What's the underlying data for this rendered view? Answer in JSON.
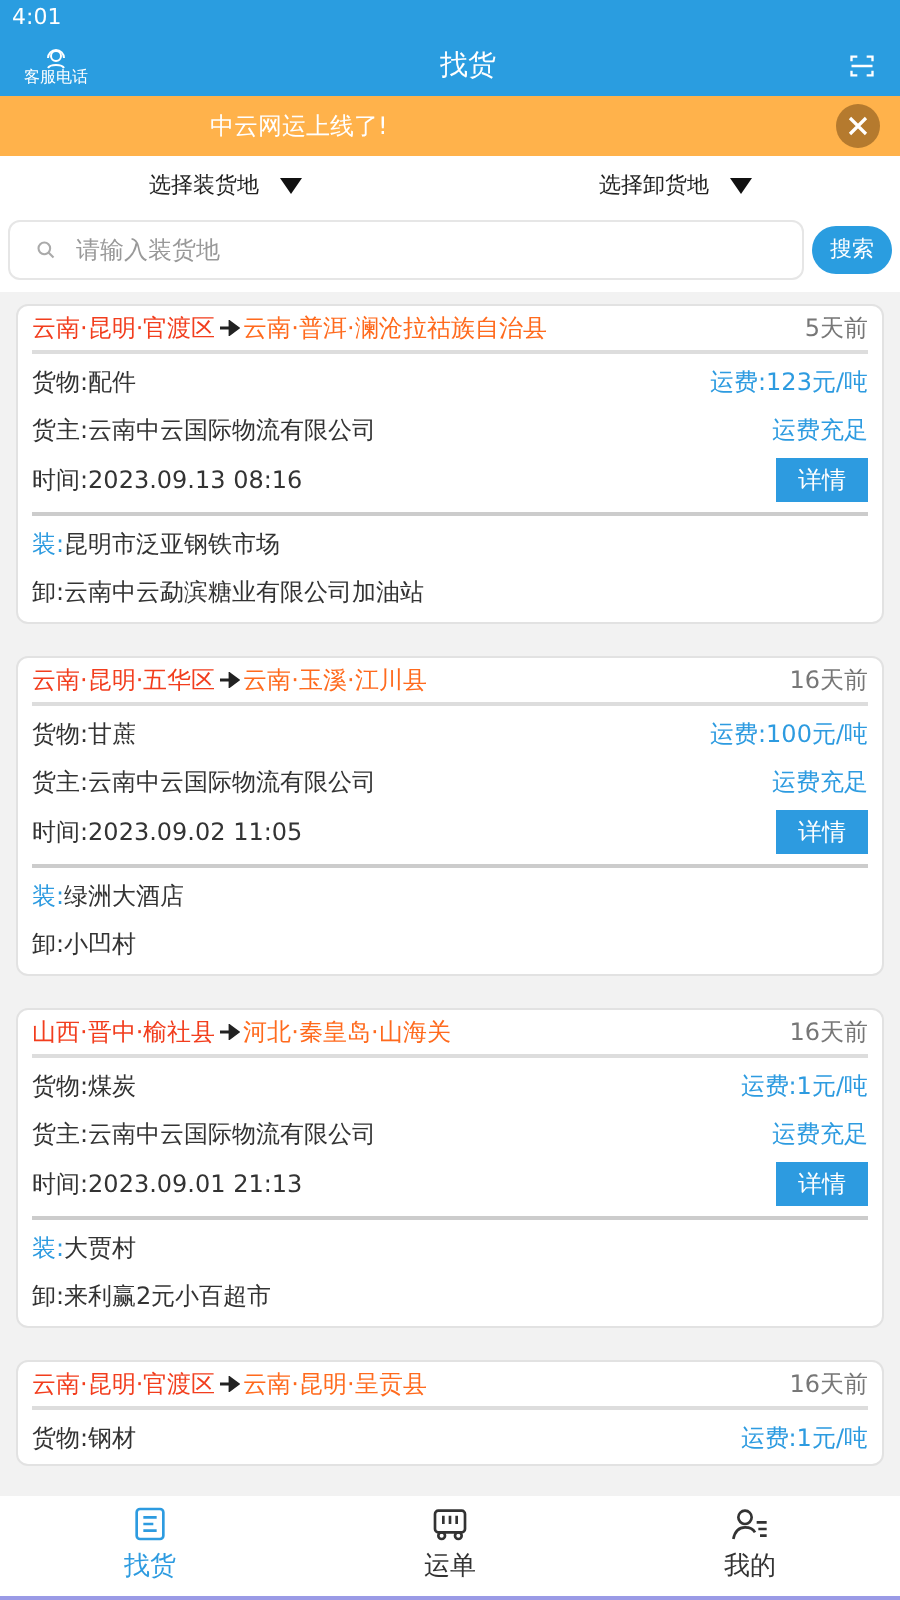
{
  "status_bar": {
    "time": "4:01"
  },
  "header": {
    "left_label": "客服电话",
    "title": "找货"
  },
  "banner": {
    "text": "中云网运上线了!"
  },
  "filters": [
    {
      "label": "选择装货地"
    },
    {
      "label": "选择卸货地"
    }
  ],
  "search": {
    "placeholder": "请输入装货地",
    "button": "搜索"
  },
  "cards": [
    {
      "origin": "云南·昆明·官渡区",
      "destination": "云南·普洱·澜沧拉祜族自治县",
      "age": "5天前",
      "cargo": "货物:配件",
      "price": "运费:123元/吨",
      "owner": "货主:云南中云国际物流有限公司",
      "payment": "运费充足",
      "time": "时间:2023.09.13 08:16",
      "button": "详情",
      "load_label": "装:",
      "load": "昆明市泛亚钢铁市场",
      "unload": "卸:云南中云勐滨糖业有限公司加油站"
    },
    {
      "origin": "云南·昆明·五华区",
      "destination": "云南·玉溪·江川县",
      "age": "16天前",
      "cargo": "货物:甘蔗",
      "price": "运费:100元/吨",
      "owner": "货主:云南中云国际物流有限公司",
      "payment": "运费充足",
      "time": "时间:2023.09.02 11:05",
      "button": "详情",
      "load_label": "装:",
      "load": "绿洲大酒店",
      "unload": "卸:小凹村"
    },
    {
      "origin": "山西·晋中·榆社县",
      "destination": "河北·秦皇岛·山海关",
      "age": "16天前",
      "cargo": "货物:煤炭",
      "price": "运费:1元/吨",
      "owner": "货主:云南中云国际物流有限公司",
      "payment": "运费充足",
      "time": "时间:2023.09.01 21:13",
      "button": "详情",
      "load_label": "装:",
      "load": "大贾村",
      "unload": "卸:来利赢2元小百超市"
    },
    {
      "origin": "云南·昆明·官渡区",
      "destination": "云南·昆明·呈贡县",
      "age": "16天前",
      "cargo": "货物:钢材",
      "price": "运费:1元/吨"
    }
  ],
  "tabs": [
    {
      "label": "找货",
      "kind": "list",
      "selected": true
    },
    {
      "label": "运单",
      "kind": "truck",
      "selected": false
    },
    {
      "label": "我的",
      "kind": "person",
      "selected": false
    }
  ]
}
